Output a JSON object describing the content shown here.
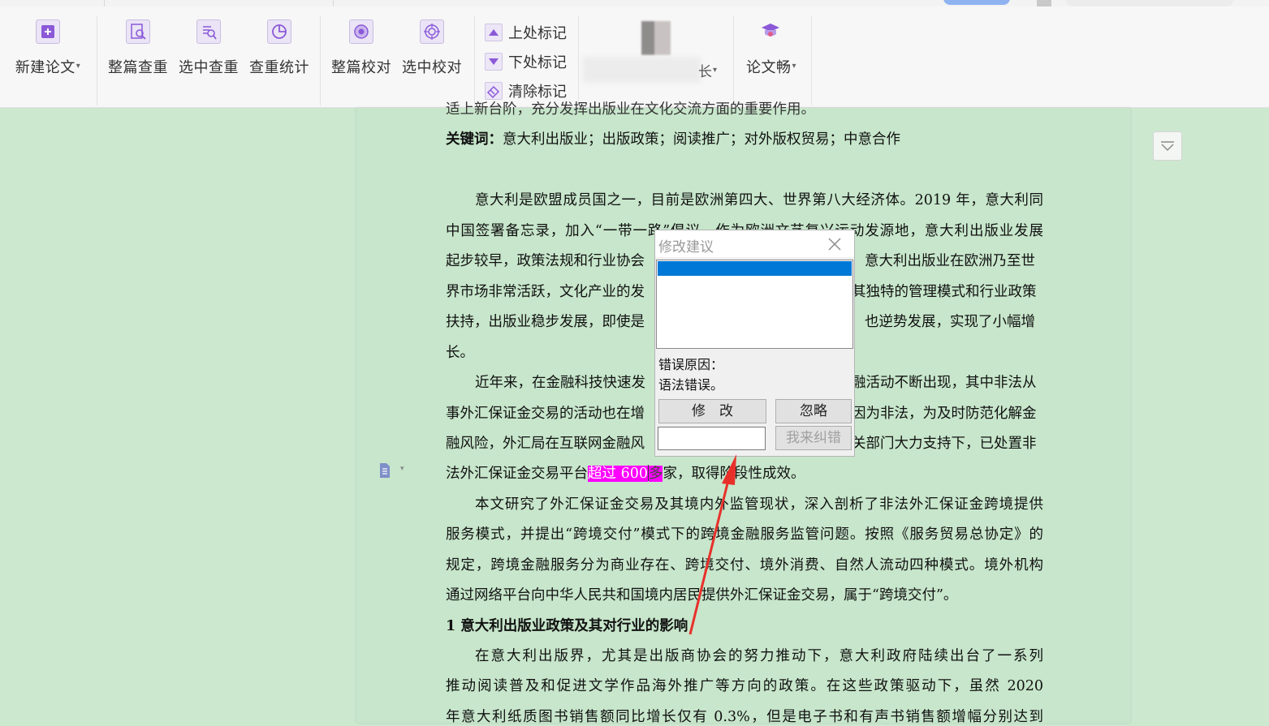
{
  "ribbon": {
    "new_paper": "新建论文",
    "full_check": "整篇查重",
    "selected_check": "选中查重",
    "check_stats": "查重统计",
    "full_proofread": "整篇校对",
    "selected_proofread": "选中校对",
    "prev_mark": "上处标记",
    "next_mark": "下处标记",
    "clear_marks": "清除标记",
    "blurred_tail": "长",
    "lunwenchang": "论文畅"
  },
  "document": {
    "line0": "适上新台阶，充分发挥出版业在文化交流方面的重要作用。",
    "keywords_label": "关键词：",
    "keywords": "意大利出版业；出版政策；阅读推广；对外版权贸易；中意合作",
    "p1": [
      "意大利是欧盟成员国之一，目前是欧洲第四大、世界第八大经济体。2019 年，意大利同",
      "中国签署备忘录，加入“一带一路”倡议。作为欧洲文艺复兴运动发源地，意大利出版业发展",
      "起步较早，政策法规和行业协会",
      "意大利出版业在欧洲乃至世",
      "界市场非常活跃，文化产业的发",
      "其独特的管理模式和行业政策",
      "扶持，出版业稳步发展，即使是",
      "也逆势发展，实现了小幅增",
      "长。"
    ],
    "p2": [
      "近年来，在金融科技快速发",
      "融活动不断出现，其中非法从",
      "事外汇保证金交易的活动也在增",
      "因为非法，为及时防范化解金",
      "融风险，外汇局在互联网金融风",
      "关部门大力支持下，已处置非",
      "法外汇保证金交易平台",
      "超过 600",
      "多",
      "家，取得阶段性成效。"
    ],
    "p3": [
      "本文研究了外汇保证金交易及其境内外监管现状，深入剖析了非法外汇保证金跨境提供",
      "服务模式，并提出“跨境交付”模式下的跨境金融服务监管问题。按照《服务贸易总协定》的",
      "规定，跨境金融服务分为商业存在、跨境交付、境外消费、自然人流动四种模式。境外机构",
      "通过网络平台向中华人民共和国境内居民提供外汇保证金交易，属于“跨境交付”。"
    ],
    "heading1": "1 意大利出版业政策及其对行业的影响",
    "p4": [
      "在意大利出版界，尤其是出版商协会的努力推动下，意大利政府陆续出台了一系列",
      "推动阅读普及和促进文学作品海外推广等方向的政策。在这些政策驱动下，虽然 2020",
      "年意大利纸质图书销售额同比增长仅有 0.3%，但是电子书和有声书销售额增幅分别达到"
    ]
  },
  "dialog": {
    "title": "修改建议",
    "reason_label": "错误原因：",
    "reason": "语法错误。",
    "modify_button": "修　改",
    "ignore_button": "忽略",
    "report_button": "我来纠错",
    "input_value": ""
  },
  "colors": {
    "page_background": "#cce8cf",
    "highlight": "#ff00ff",
    "selection": "#0078d7",
    "arrow": "#e8302a"
  }
}
